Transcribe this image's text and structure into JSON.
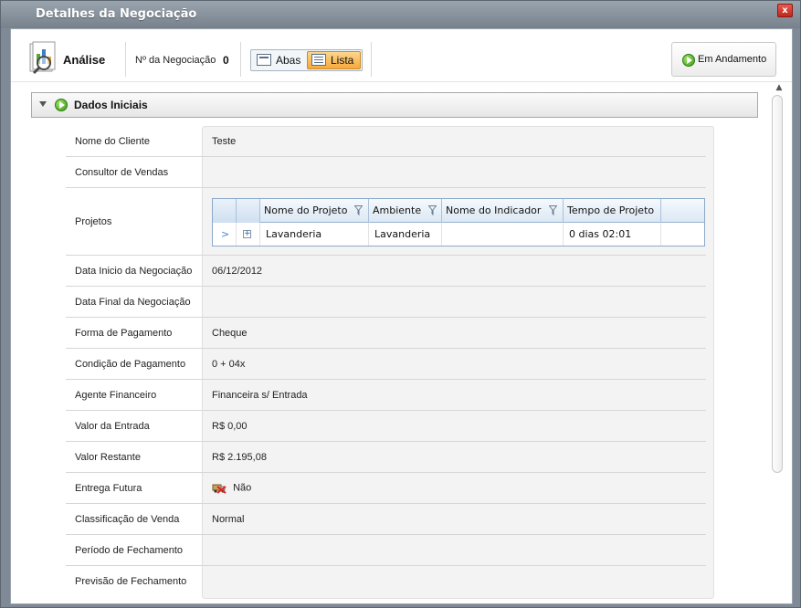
{
  "window": {
    "title": "Detalhes da Negociação",
    "close_label": "x"
  },
  "toolbar": {
    "analise_label": "Análise",
    "negociacao_label": "Nº da Negociação",
    "negociacao_value": "0",
    "view_toggle": {
      "abas_label": "Abas",
      "lista_label": "Lista",
      "selected": "Lista"
    },
    "status_label": "Em Andamento"
  },
  "section": {
    "title": "Dados Iniciais"
  },
  "fields": {
    "nome_cliente": {
      "label": "Nome do Cliente",
      "value": "Teste"
    },
    "consultor": {
      "label": "Consultor de Vendas",
      "value": ""
    },
    "projetos": {
      "label": "Projetos"
    },
    "data_inicio": {
      "label": "Data Inicio da Negociação",
      "value": "06/12/2012"
    },
    "data_final": {
      "label": "Data Final da Negociação",
      "value": ""
    },
    "forma_pagamento": {
      "label": "Forma de Pagamento",
      "value": "Cheque"
    },
    "condicao_pagamento": {
      "label": "Condição de Pagamento",
      "value": "0 + 04x"
    },
    "agente_financeiro": {
      "label": "Agente Financeiro",
      "value": "Financeira s/ Entrada"
    },
    "valor_entrada": {
      "label": "Valor da Entrada",
      "value": "R$ 0,00"
    },
    "valor_restante": {
      "label": "Valor Restante",
      "value": "R$ 2.195,08"
    },
    "entrega_futura": {
      "label": "Entrega Futura",
      "value": "Não"
    },
    "classificacao_venda": {
      "label": "Classificação de Venda",
      "value": "Normal"
    },
    "periodo_fechamento": {
      "label": "Período de Fechamento",
      "value": ""
    },
    "previsao_fechamento": {
      "label": "Previsão de Fechamento",
      "value": ""
    }
  },
  "projects_grid": {
    "columns": [
      "Nome do Projeto",
      "Ambiente",
      "Nome do Indicador",
      "Tempo de Projeto"
    ],
    "rows": [
      [
        "Lavanderia",
        "Lavanderia",
        "",
        "0 dias 02:01"
      ]
    ],
    "row_arrow": ">",
    "expand_symbol": "+"
  },
  "colors": {
    "accent_orange": "#f5a93b",
    "status_green": "#3b9a14",
    "grid_header_blue": "#dce8f4"
  }
}
